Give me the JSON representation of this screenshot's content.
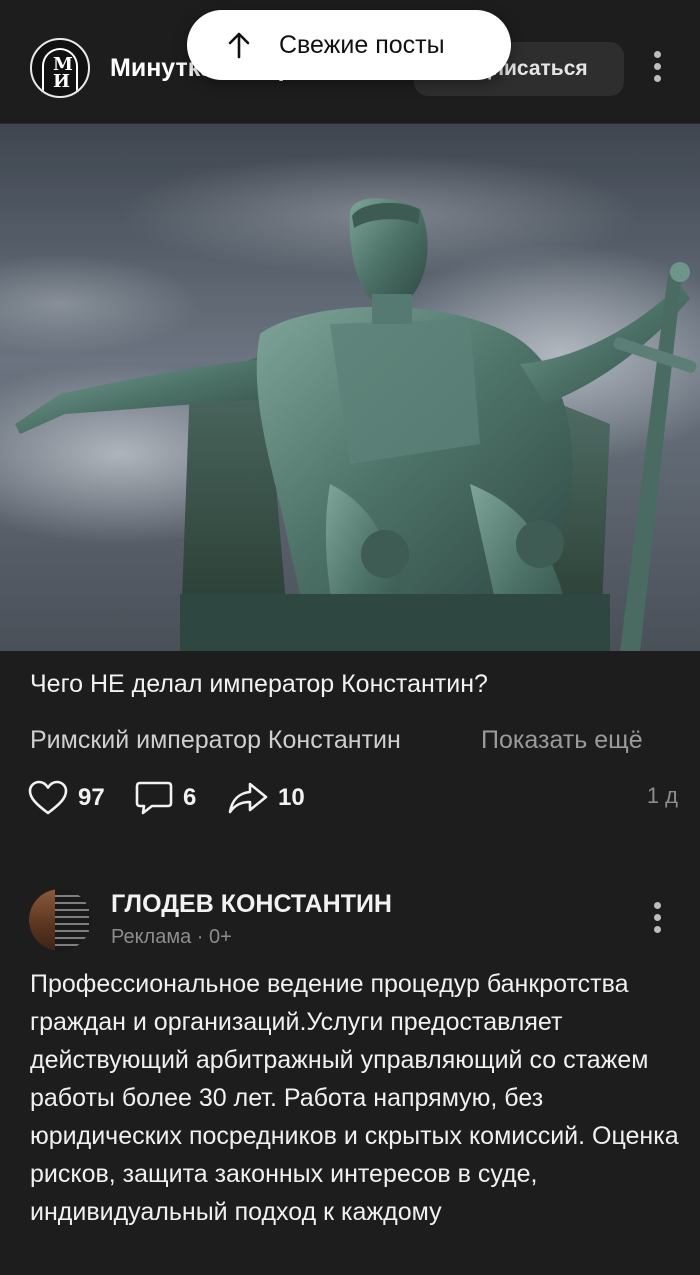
{
  "header": {
    "channel_name": "Минутка истории",
    "logo_letter_top": "М",
    "logo_letter_bottom": "И",
    "subscribe_label": "Подписаться",
    "more_icon": "kebab-vertical-icon"
  },
  "toast": {
    "label": "Свежие посты",
    "icon": "arrow-up-icon"
  },
  "post": {
    "title": "Чего НЕ делал император Константин?",
    "excerpt": "Римский император Константин",
    "show_more": "Показать ещё",
    "likes": "97",
    "comments": "6",
    "shares": "10",
    "age": "1 д",
    "image_alt": "bronze statue of emperor Constantine on throne"
  },
  "ad": {
    "author": "ГЛОДЕВ КОНСТАНТИН",
    "meta": "Реклама · 0+",
    "text": "Профессиональное ведение процедур банкротства граждан и организаций.Услуги предоставляет действующий арбитражный управляющий со стажем работы более 30 лет. Работа напрямую, без юридических посредников и скрытых комиссий. Оценка рисков, защита законных интересов в суде, индивидуальный подход к каждому"
  },
  "colors": {
    "background": "#1d1d1d",
    "button_bg": "#2e2e2e",
    "muted_text": "#8d8d8d"
  }
}
